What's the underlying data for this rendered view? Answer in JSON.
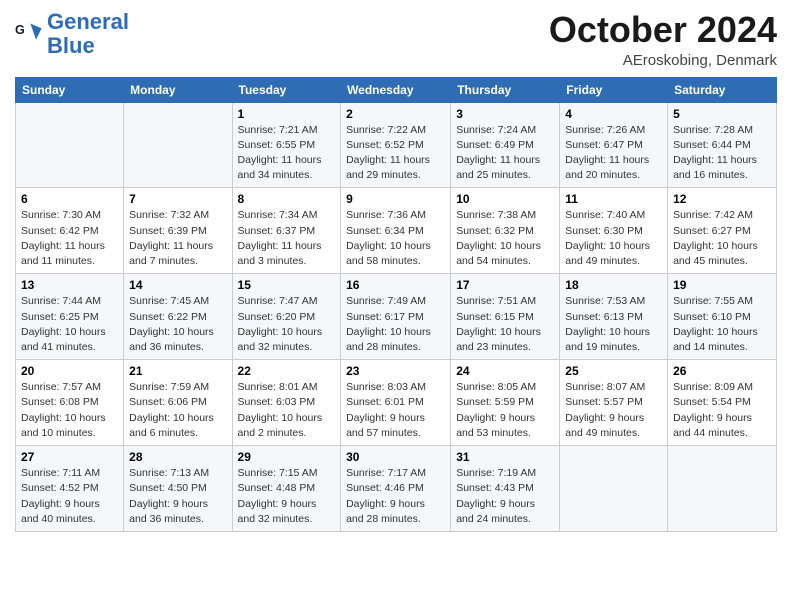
{
  "header": {
    "logo_general": "General",
    "logo_blue": "Blue",
    "month_title": "October 2024",
    "location": "AEroskobing, Denmark"
  },
  "days_of_week": [
    "Sunday",
    "Monday",
    "Tuesday",
    "Wednesday",
    "Thursday",
    "Friday",
    "Saturday"
  ],
  "weeks": [
    [
      {
        "day": "",
        "sunrise": "",
        "sunset": "",
        "daylight": ""
      },
      {
        "day": "",
        "sunrise": "",
        "sunset": "",
        "daylight": ""
      },
      {
        "day": "1",
        "sunrise": "Sunrise: 7:21 AM",
        "sunset": "Sunset: 6:55 PM",
        "daylight": "Daylight: 11 hours and 34 minutes."
      },
      {
        "day": "2",
        "sunrise": "Sunrise: 7:22 AM",
        "sunset": "Sunset: 6:52 PM",
        "daylight": "Daylight: 11 hours and 29 minutes."
      },
      {
        "day": "3",
        "sunrise": "Sunrise: 7:24 AM",
        "sunset": "Sunset: 6:49 PM",
        "daylight": "Daylight: 11 hours and 25 minutes."
      },
      {
        "day": "4",
        "sunrise": "Sunrise: 7:26 AM",
        "sunset": "Sunset: 6:47 PM",
        "daylight": "Daylight: 11 hours and 20 minutes."
      },
      {
        "day": "5",
        "sunrise": "Sunrise: 7:28 AM",
        "sunset": "Sunset: 6:44 PM",
        "daylight": "Daylight: 11 hours and 16 minutes."
      }
    ],
    [
      {
        "day": "6",
        "sunrise": "Sunrise: 7:30 AM",
        "sunset": "Sunset: 6:42 PM",
        "daylight": "Daylight: 11 hours and 11 minutes."
      },
      {
        "day": "7",
        "sunrise": "Sunrise: 7:32 AM",
        "sunset": "Sunset: 6:39 PM",
        "daylight": "Daylight: 11 hours and 7 minutes."
      },
      {
        "day": "8",
        "sunrise": "Sunrise: 7:34 AM",
        "sunset": "Sunset: 6:37 PM",
        "daylight": "Daylight: 11 hours and 3 minutes."
      },
      {
        "day": "9",
        "sunrise": "Sunrise: 7:36 AM",
        "sunset": "Sunset: 6:34 PM",
        "daylight": "Daylight: 10 hours and 58 minutes."
      },
      {
        "day": "10",
        "sunrise": "Sunrise: 7:38 AM",
        "sunset": "Sunset: 6:32 PM",
        "daylight": "Daylight: 10 hours and 54 minutes."
      },
      {
        "day": "11",
        "sunrise": "Sunrise: 7:40 AM",
        "sunset": "Sunset: 6:30 PM",
        "daylight": "Daylight: 10 hours and 49 minutes."
      },
      {
        "day": "12",
        "sunrise": "Sunrise: 7:42 AM",
        "sunset": "Sunset: 6:27 PM",
        "daylight": "Daylight: 10 hours and 45 minutes."
      }
    ],
    [
      {
        "day": "13",
        "sunrise": "Sunrise: 7:44 AM",
        "sunset": "Sunset: 6:25 PM",
        "daylight": "Daylight: 10 hours and 41 minutes."
      },
      {
        "day": "14",
        "sunrise": "Sunrise: 7:45 AM",
        "sunset": "Sunset: 6:22 PM",
        "daylight": "Daylight: 10 hours and 36 minutes."
      },
      {
        "day": "15",
        "sunrise": "Sunrise: 7:47 AM",
        "sunset": "Sunset: 6:20 PM",
        "daylight": "Daylight: 10 hours and 32 minutes."
      },
      {
        "day": "16",
        "sunrise": "Sunrise: 7:49 AM",
        "sunset": "Sunset: 6:17 PM",
        "daylight": "Daylight: 10 hours and 28 minutes."
      },
      {
        "day": "17",
        "sunrise": "Sunrise: 7:51 AM",
        "sunset": "Sunset: 6:15 PM",
        "daylight": "Daylight: 10 hours and 23 minutes."
      },
      {
        "day": "18",
        "sunrise": "Sunrise: 7:53 AM",
        "sunset": "Sunset: 6:13 PM",
        "daylight": "Daylight: 10 hours and 19 minutes."
      },
      {
        "day": "19",
        "sunrise": "Sunrise: 7:55 AM",
        "sunset": "Sunset: 6:10 PM",
        "daylight": "Daylight: 10 hours and 14 minutes."
      }
    ],
    [
      {
        "day": "20",
        "sunrise": "Sunrise: 7:57 AM",
        "sunset": "Sunset: 6:08 PM",
        "daylight": "Daylight: 10 hours and 10 minutes."
      },
      {
        "day": "21",
        "sunrise": "Sunrise: 7:59 AM",
        "sunset": "Sunset: 6:06 PM",
        "daylight": "Daylight: 10 hours and 6 minutes."
      },
      {
        "day": "22",
        "sunrise": "Sunrise: 8:01 AM",
        "sunset": "Sunset: 6:03 PM",
        "daylight": "Daylight: 10 hours and 2 minutes."
      },
      {
        "day": "23",
        "sunrise": "Sunrise: 8:03 AM",
        "sunset": "Sunset: 6:01 PM",
        "daylight": "Daylight: 9 hours and 57 minutes."
      },
      {
        "day": "24",
        "sunrise": "Sunrise: 8:05 AM",
        "sunset": "Sunset: 5:59 PM",
        "daylight": "Daylight: 9 hours and 53 minutes."
      },
      {
        "day": "25",
        "sunrise": "Sunrise: 8:07 AM",
        "sunset": "Sunset: 5:57 PM",
        "daylight": "Daylight: 9 hours and 49 minutes."
      },
      {
        "day": "26",
        "sunrise": "Sunrise: 8:09 AM",
        "sunset": "Sunset: 5:54 PM",
        "daylight": "Daylight: 9 hours and 44 minutes."
      }
    ],
    [
      {
        "day": "27",
        "sunrise": "Sunrise: 7:11 AM",
        "sunset": "Sunset: 4:52 PM",
        "daylight": "Daylight: 9 hours and 40 minutes."
      },
      {
        "day": "28",
        "sunrise": "Sunrise: 7:13 AM",
        "sunset": "Sunset: 4:50 PM",
        "daylight": "Daylight: 9 hours and 36 minutes."
      },
      {
        "day": "29",
        "sunrise": "Sunrise: 7:15 AM",
        "sunset": "Sunset: 4:48 PM",
        "daylight": "Daylight: 9 hours and 32 minutes."
      },
      {
        "day": "30",
        "sunrise": "Sunrise: 7:17 AM",
        "sunset": "Sunset: 4:46 PM",
        "daylight": "Daylight: 9 hours and 28 minutes."
      },
      {
        "day": "31",
        "sunrise": "Sunrise: 7:19 AM",
        "sunset": "Sunset: 4:43 PM",
        "daylight": "Daylight: 9 hours and 24 minutes."
      },
      {
        "day": "",
        "sunrise": "",
        "sunset": "",
        "daylight": ""
      },
      {
        "day": "",
        "sunrise": "",
        "sunset": "",
        "daylight": ""
      }
    ]
  ]
}
